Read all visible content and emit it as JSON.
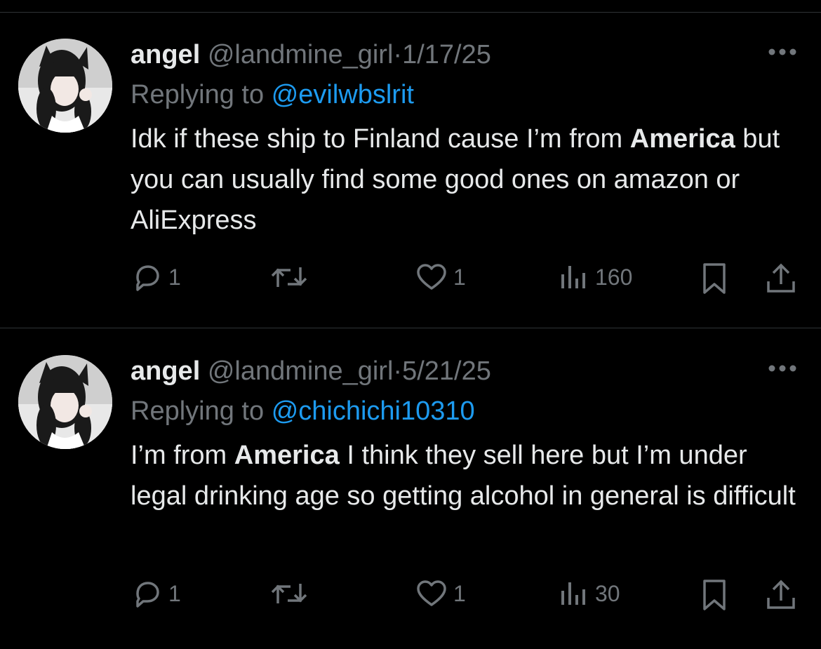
{
  "tweets": [
    {
      "name": "angel",
      "handle": "@landmine_girl",
      "separator": "·",
      "date": "1/17/25",
      "replying_prefix": "Replying to",
      "replying_to": "@evilwbslrit",
      "text_parts": [
        "Idk if these ship to Finland cause I’m from ",
        "America",
        " but you can usually find some good ones on amazon or AliExpress"
      ],
      "replies": "1",
      "likes": "1",
      "views": "160",
      "icons": [
        "reply-icon",
        "repost-icon",
        "like-icon",
        "views-icon",
        "bookmark-icon",
        "share-icon"
      ]
    },
    {
      "name": "angel",
      "handle": "@landmine_girl",
      "separator": "·",
      "date": "5/21/25",
      "replying_prefix": "Replying to",
      "replying_to": "@chichichi10310",
      "text_parts": [
        "I’m from ",
        "America",
        " I think they sell here but I’m under legal drinking age so getting alcohol in general is difficult"
      ],
      "replies": "1",
      "likes": "1",
      "views": "30",
      "icons": [
        "reply-icon",
        "repost-icon",
        "like-icon",
        "views-icon",
        "bookmark-icon",
        "share-icon"
      ]
    }
  ],
  "colors": {
    "background": "#000000",
    "text": "#e7e9ea",
    "muted": "#71767b",
    "link": "#1d9bf0",
    "divider": "#2f3336"
  }
}
